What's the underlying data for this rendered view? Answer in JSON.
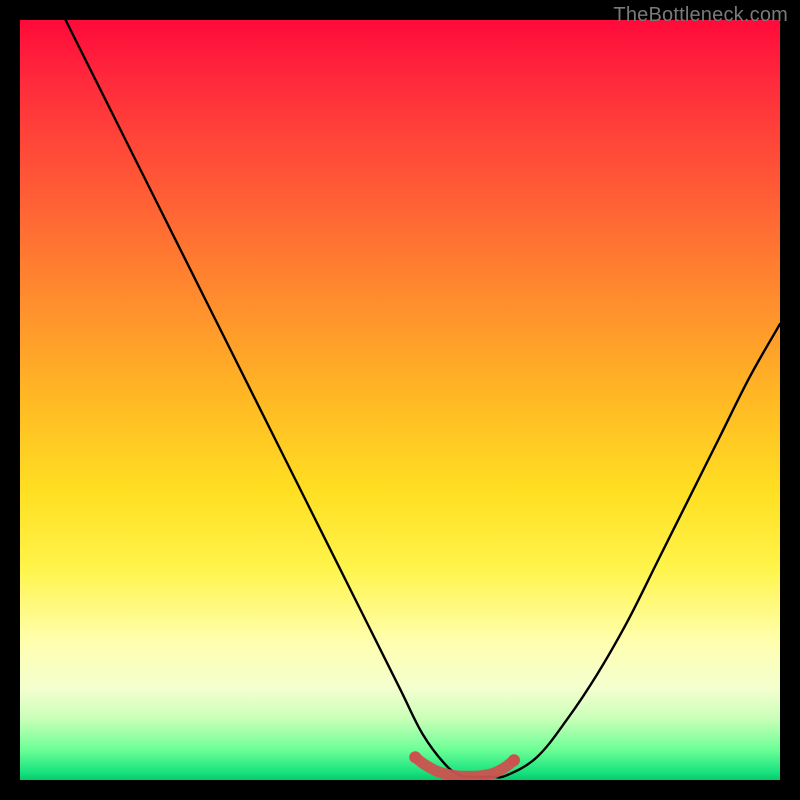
{
  "watermark": "TheBottleneck.com",
  "colors": {
    "curve": "#000000",
    "accent": "#cc524f",
    "frame": "#000000"
  },
  "chart_data": {
    "type": "line",
    "title": "",
    "xlabel": "",
    "ylabel": "",
    "xlim": [
      0,
      100
    ],
    "ylim": [
      0,
      100
    ],
    "grid": false,
    "legend": false,
    "series": [
      {
        "name": "curve",
        "color": "#000000",
        "x": [
          6,
          10,
          14,
          18,
          22,
          26,
          30,
          34,
          38,
          42,
          46,
          50,
          53,
          56,
          58,
          60,
          62,
          64,
          68,
          72,
          76,
          80,
          84,
          88,
          92,
          96,
          100
        ],
        "y": [
          100,
          92,
          84,
          76,
          68,
          60,
          52,
          44,
          36,
          28,
          20,
          12,
          6,
          2,
          0.6,
          0.4,
          0.4,
          0.6,
          3,
          8,
          14,
          21,
          29,
          37,
          45,
          53,
          60
        ]
      },
      {
        "name": "accent-bottom",
        "color": "#cc524f",
        "x": [
          52,
          53,
          54,
          55,
          56,
          57,
          58,
          59,
          60,
          61,
          62,
          63,
          64,
          65
        ],
        "y": [
          3.0,
          2.2,
          1.6,
          1.1,
          0.8,
          0.6,
          0.5,
          0.5,
          0.5,
          0.6,
          0.8,
          1.2,
          1.8,
          2.6
        ]
      }
    ],
    "annotations": [
      {
        "text": "TheBottleneck.com",
        "position": "top-right",
        "color": "#7a7a7a"
      }
    ]
  }
}
